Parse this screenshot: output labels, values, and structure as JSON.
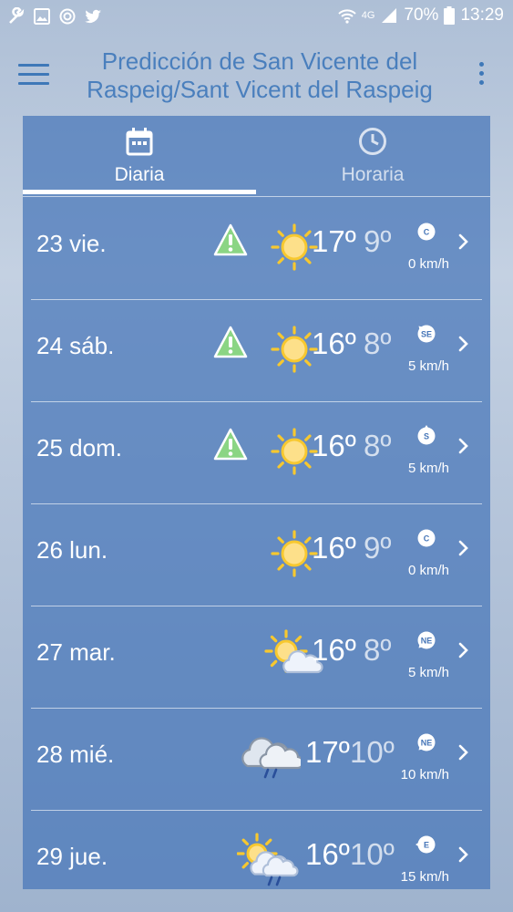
{
  "status_bar": {
    "battery": "70%",
    "time": "13:29",
    "network": "4G"
  },
  "header": {
    "title": "Predicción de San Vicente del Raspeig/Sant Vicent del Raspeig"
  },
  "tabs": [
    {
      "label": "Diaria",
      "icon": "calendar-icon",
      "active": true
    },
    {
      "label": "Horaria",
      "icon": "clock-icon",
      "active": false
    }
  ],
  "days": [
    {
      "day": "23 vie.",
      "warning": true,
      "weather": "sunny",
      "max": "17º",
      "min": "9º",
      "wind_dir": "C",
      "wind_speed": "0 km/h"
    },
    {
      "day": "24 sáb.",
      "warning": true,
      "weather": "sunny",
      "max": "16º",
      "min": "8º",
      "wind_dir": "SE",
      "wind_speed": "5 km/h"
    },
    {
      "day": "25 dom.",
      "warning": true,
      "weather": "sunny",
      "max": "16º",
      "min": "8º",
      "wind_dir": "S",
      "wind_speed": "5 km/h"
    },
    {
      "day": "26 lun.",
      "warning": false,
      "weather": "sunny",
      "max": "16º",
      "min": "9º",
      "wind_dir": "C",
      "wind_speed": "0 km/h"
    },
    {
      "day": "27 mar.",
      "warning": false,
      "weather": "partly-cloudy",
      "max": "16º",
      "min": "8º",
      "wind_dir": "NE",
      "wind_speed": "5 km/h"
    },
    {
      "day": "28 mié.",
      "warning": false,
      "weather": "cloudy-rain",
      "max": "17º",
      "min": "10º",
      "wind_dir": "NE",
      "wind_speed": "10 km/h"
    },
    {
      "day": "29 jue.",
      "warning": false,
      "weather": "partly-cloudy-rain",
      "max": "16º",
      "min": "10º",
      "wind_dir": "E",
      "wind_speed": "15 km/h"
    }
  ],
  "colors": {
    "accent": "#3e78b8",
    "panel": "#4676b8",
    "warning": "#7ed07a",
    "sun": "#fbd03a"
  }
}
